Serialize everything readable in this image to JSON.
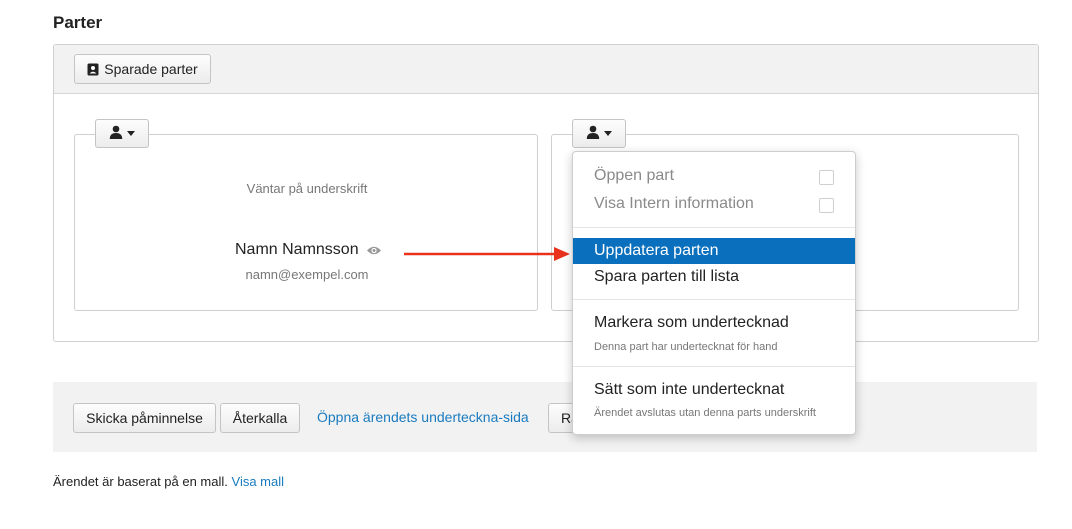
{
  "section_title": "Parter",
  "toolbar": {
    "saved_parties_label": "Sparade parter"
  },
  "party": {
    "status": "Väntar på underskrift",
    "name": "Namn Namnsson",
    "email": "namn@exempel.com"
  },
  "menu": {
    "open_party": "Öppen part",
    "show_internal": "Visa Intern information",
    "update_party": "Uppdatera parten",
    "save_to_list": "Spara parten till lista",
    "mark_signed": "Markera som undertecknad",
    "mark_signed_sub": "Denna part har undertecknat för hand",
    "set_unsigned": "Sätt som inte undertecknat",
    "set_unsigned_sub": "Ärendet avslutas utan denna parts underskrift"
  },
  "footer": {
    "remind_label": "Skicka påminnelse",
    "revoke_label": "Återkalla",
    "open_sign_page_link": "Öppna ärendets underteckna-sida",
    "partial_button_label": "Ra"
  },
  "note": {
    "text": "Ärendet är baserat på en mall.",
    "link": "Visa mall"
  },
  "colors": {
    "accent": "#0a6fbd",
    "link": "#1a7bbf",
    "arrow": "#e8321e"
  }
}
